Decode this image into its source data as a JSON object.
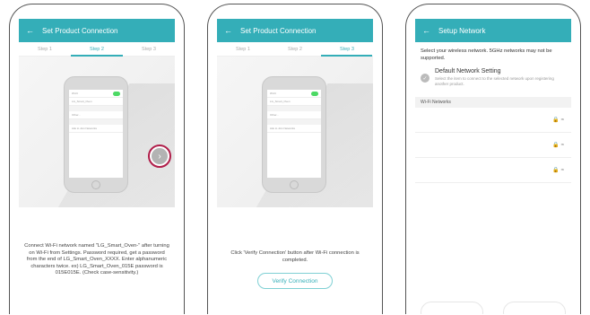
{
  "screen1": {
    "title": "Set Product Connection",
    "steps": [
      "Step 1",
      "Step 2",
      "Step 3"
    ],
    "instruction": "Connect Wi-Fi network named \"LG_Smart_Oven-\" after turning on Wi-Fi from Settings. Password required, get a password from the end of LG_Smart_Oven_XXXX. Enter alphanumeric characters twice. ex) LG_Smart_Oven_015E password is 015E015E. (Check case-sensitivity.)"
  },
  "screen2": {
    "title": "Set Product Connection",
    "steps": [
      "Step 1",
      "Step 2",
      "Step 3"
    ],
    "instruction": "Click 'Verify Connection' button after Wi-Fi connection is completed.",
    "verify_label": "Verify Connection"
  },
  "screen3": {
    "title": "Setup Network",
    "description": "Select your wireless network. 5GHz networks may not be supported.",
    "default_title": "Default Network Setting",
    "default_sub": "Select the item to connect to the selected network upon registering another product.",
    "section": "Wi-Fi Networks",
    "networks": [
      " ",
      " ",
      " "
    ]
  },
  "device": {
    "rows": [
      "Wi-Fi",
      "LG_Smart_Oven",
      "Other...",
      "Ask to Join Networks"
    ]
  },
  "icons": {
    "back": "back-arrow-icon",
    "next": "chevron-right-icon",
    "lock": "lock-icon",
    "wifi": "wifi-icon"
  },
  "colors": {
    "accent": "#34aeb8",
    "highlight_ring": "#b01e4a"
  }
}
